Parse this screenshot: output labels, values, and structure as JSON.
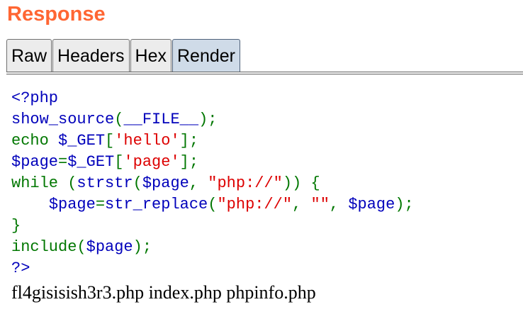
{
  "panel": {
    "title": "Response"
  },
  "tabs": [
    {
      "label": "Raw",
      "active": false
    },
    {
      "label": "Headers",
      "active": false
    },
    {
      "label": "Hex",
      "active": false
    },
    {
      "label": "Render",
      "active": true
    }
  ],
  "code_lines": [
    [
      {
        "t": "<?php",
        "c": "vr"
      }
    ],
    [
      {
        "t": "show_source",
        "c": "vr"
      },
      {
        "t": "(",
        "c": "kw"
      },
      {
        "t": "__FILE__",
        "c": "vr"
      },
      {
        "t": ");",
        "c": "kw"
      }
    ],
    [
      {
        "t": "echo ",
        "c": "kw"
      },
      {
        "t": "$_GET",
        "c": "vr"
      },
      {
        "t": "[",
        "c": "kw"
      },
      {
        "t": "'hello'",
        "c": "st"
      },
      {
        "t": "];",
        "c": "kw"
      }
    ],
    [
      {
        "t": "$page",
        "c": "vr"
      },
      {
        "t": "=",
        "c": "kw"
      },
      {
        "t": "$_GET",
        "c": "vr"
      },
      {
        "t": "[",
        "c": "kw"
      },
      {
        "t": "'page'",
        "c": "st"
      },
      {
        "t": "];",
        "c": "kw"
      }
    ],
    [
      {
        "t": "while ",
        "c": "kw"
      },
      {
        "t": "(",
        "c": "kw"
      },
      {
        "t": "strstr",
        "c": "vr"
      },
      {
        "t": "(",
        "c": "kw"
      },
      {
        "t": "$page",
        "c": "vr"
      },
      {
        "t": ", ",
        "c": "kw"
      },
      {
        "t": "\"php://\"",
        "c": "st"
      },
      {
        "t": ")) {",
        "c": "kw"
      }
    ],
    [
      {
        "t": "    ",
        "c": "kw"
      },
      {
        "t": "$page",
        "c": "vr"
      },
      {
        "t": "=",
        "c": "kw"
      },
      {
        "t": "str_replace",
        "c": "vr"
      },
      {
        "t": "(",
        "c": "kw"
      },
      {
        "t": "\"php://\"",
        "c": "st"
      },
      {
        "t": ", ",
        "c": "kw"
      },
      {
        "t": "\"\"",
        "c": "st"
      },
      {
        "t": ", ",
        "c": "kw"
      },
      {
        "t": "$page",
        "c": "vr"
      },
      {
        "t": ");",
        "c": "kw"
      }
    ],
    [
      {
        "t": "}",
        "c": "kw"
      }
    ],
    [
      {
        "t": "include",
        "c": "kw"
      },
      {
        "t": "(",
        "c": "kw"
      },
      {
        "t": "$page",
        "c": "vr"
      },
      {
        "t": ");",
        "c": "kw"
      }
    ],
    [
      {
        "t": "?>",
        "c": "vr"
      }
    ]
  ],
  "output": {
    "file_list": "fl4gisisish3r3.php index.php phpinfo.php"
  },
  "colors": {
    "title": "#ff6633",
    "tab_active_bg": "#cfdbe8",
    "tab_bg": "#ececec",
    "code_keyword": "#007700",
    "code_default": "#0000bb",
    "code_string": "#dd0000"
  }
}
